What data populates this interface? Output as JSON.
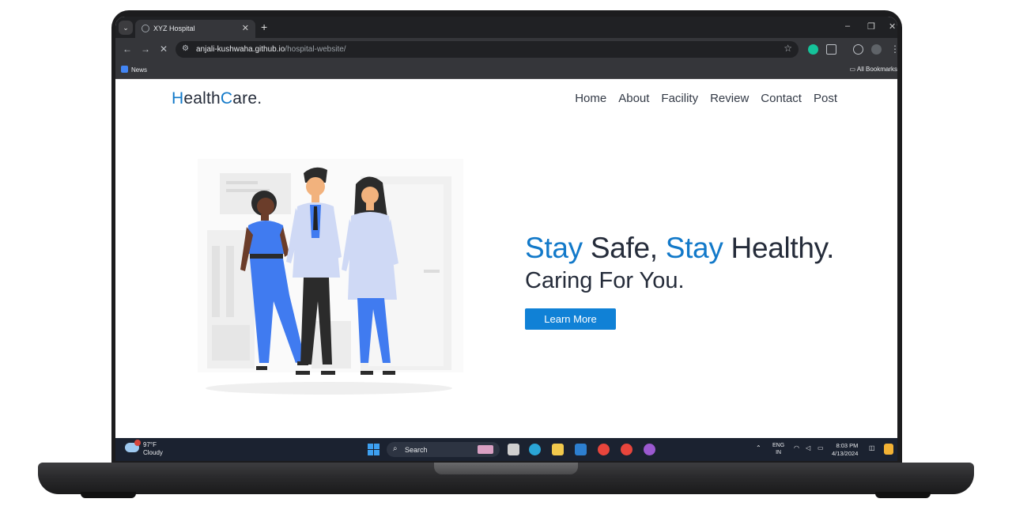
{
  "browser": {
    "tab_title": "XYZ Hospital",
    "tab_close": "✕",
    "new_tab": "+",
    "url_host": "anjali-kushwaha.github.io",
    "url_path": "/hospital-website/",
    "bookmark_news": "News",
    "bookmark_all": "All Bookmarks",
    "icons": [
      "tab-search-icon",
      "back-icon",
      "forward-icon",
      "stop-icon",
      "site-info-icon",
      "bookmark-star-icon",
      "grammarly-icon",
      "extensions-icon",
      "minimize-icon",
      "restore-icon",
      "close-icon"
    ]
  },
  "site": {
    "logo_h": "H",
    "logo_mid": "ealth",
    "logo_c": "C",
    "logo_end": "are.",
    "nav": [
      "Home",
      "About",
      "Facility",
      "Review",
      "Contact",
      "Post"
    ],
    "hero": {
      "w1": "Stay",
      "w2": " Safe, ",
      "w3": "Stay",
      "w4": " Healthy.",
      "subtitle": "Caring For You.",
      "cta": "Learn More"
    },
    "colors": {
      "accent": "#1279c9",
      "text": "#252c3a",
      "button": "#1081d6"
    }
  },
  "taskbar": {
    "weather_temp": "97°F",
    "weather_cond": "Cloudy",
    "search": "Search",
    "lang_1": "ENG",
    "lang_2": "IN",
    "time": "8:03 PM",
    "date": "4/13/2024"
  }
}
